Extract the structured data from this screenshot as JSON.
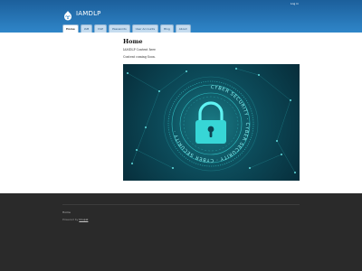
{
  "header": {
    "login_label": "Log in",
    "site_name": "IAMDLP"
  },
  "nav": {
    "tabs": [
      {
        "label": "Home",
        "active": true
      },
      {
        "label": "IAM"
      },
      {
        "label": "DLP"
      },
      {
        "label": "Passwords"
      },
      {
        "label": "User Accounts"
      },
      {
        "label": "Blog"
      },
      {
        "label": "About"
      }
    ]
  },
  "main": {
    "title": "Home",
    "paragraphs": [
      "IAMDLP Content here",
      "Content coming Soon."
    ],
    "hero_text": "CYBER SECURITY · CYBER SECURITY · CYBER SECURITY ·"
  },
  "footer": {
    "nav_label": "Home",
    "credit_prefix": "Powered by",
    "credit_link": "Drupal"
  },
  "colors": {
    "header_top": "#1c5f9b",
    "header_bottom": "#2f86c9",
    "footer_bg": "#2a2a2a",
    "hero_accent": "#3fe8e8"
  }
}
